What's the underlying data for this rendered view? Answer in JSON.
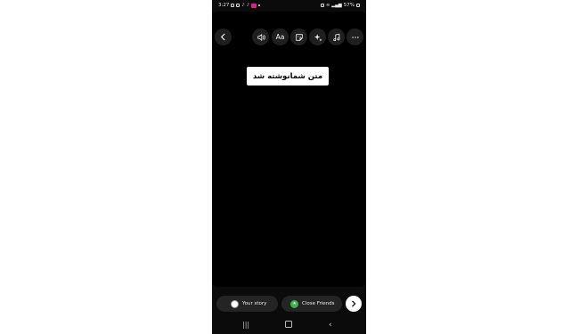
{
  "status_bar": {
    "time": "3:27",
    "battery": "57%"
  },
  "toolbar": {
    "back_icon": "chevron-left-icon",
    "sound_icon": "speaker-icon",
    "text_label": "Aa",
    "sticker_icon": "sticker-icon",
    "effects_icon": "sparkles-icon",
    "music_icon": "music-note-icon",
    "more_icon": "more-horizontal-icon"
  },
  "caption": {
    "text": "متن شمانوشته شد"
  },
  "share": {
    "your_story_label": "Your story",
    "close_friends_label": "Close Friends",
    "close_friends_color": "#3bb34a",
    "next_icon": "chevron-right-icon"
  },
  "navbar": {
    "recents_icon": "recents-icon",
    "home_icon": "home-icon",
    "back_icon": "nav-back-icon"
  }
}
